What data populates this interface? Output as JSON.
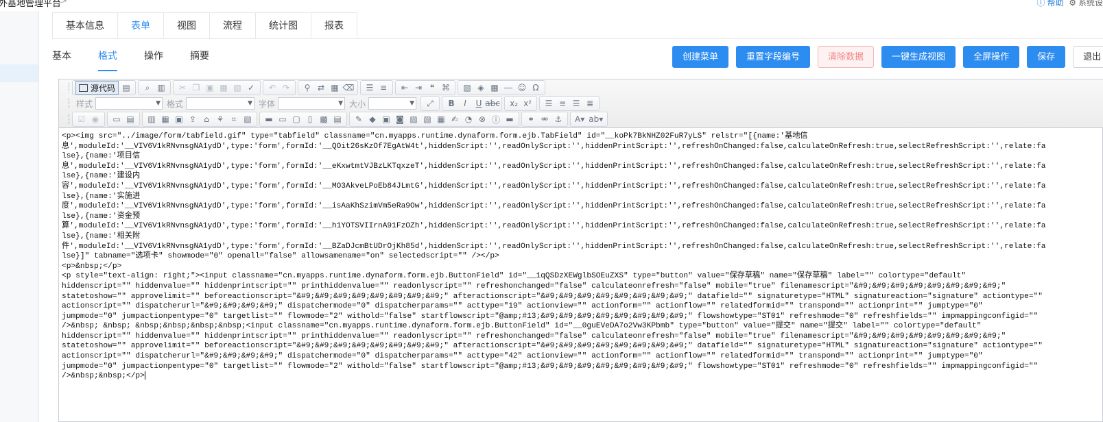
{
  "app": {
    "title": "外基地管理平台",
    "chevron": ">",
    "top_right": {
      "help_label": "帮助",
      "settings_label": "系统设"
    }
  },
  "tabs_primary": [
    {
      "label": "基本信息",
      "active": false
    },
    {
      "label": "表单",
      "active": true
    },
    {
      "label": "视图",
      "active": false
    },
    {
      "label": "流程",
      "active": false
    },
    {
      "label": "统计图",
      "active": false
    },
    {
      "label": "报表",
      "active": false
    }
  ],
  "tabs_secondary": [
    {
      "label": "基本",
      "active": false
    },
    {
      "label": "格式",
      "active": true
    },
    {
      "label": "操作",
      "active": false
    },
    {
      "label": "摘要",
      "active": false
    }
  ],
  "actions": {
    "create_menu": "创建菜单",
    "reset_field_number": "重置字段编号",
    "clear_data": "清除数据",
    "generate_view": "一键生成视图",
    "fullscreen": "全屏操作",
    "save": "保存",
    "exit": "退出"
  },
  "editor": {
    "source_label": "源代码",
    "style_label": "样式",
    "format_label": "格式",
    "font_label": "字体",
    "size_label": "大小",
    "lines": [
      "<p><img src=\"../image/form/tabfield.gif\" type=\"tabfield\" classname=\"cn.myapps.runtime.dynaform.form.ejb.TabField\" id=\"__koPk7BkNHZ02FuR7yLS\" relstr=\"[{name:'基地信",
      "息',moduleId:'__VIV6V1kRNvnsgNA1ydD',type:'form',formId:'__QOit26sKzOf7EgAtW4t',hiddenScript:'',readOnlyScript:'',hiddenPrintScript:'',refreshOnChanged:false,calculateOnRefresh:true,selectRefreshScript:'',relate:fa",
      "lse},{name:'项目信",
      "息',moduleId:'__VIV6V1kRNvnsgNA1ydD',type:'form',formId:'__eKxwtmtVJBzLKTqxzeT',hiddenScript:'',readOnlyScript:'',hiddenPrintScript:'',refreshOnChanged:false,calculateOnRefresh:true,selectRefreshScript:'',relate:fa",
      "lse},{name:'建设内",
      "容',moduleId:'__VIV6V1kRNvnsgNA1ydD',type:'form',formId:'__MO3AkveLPoEb84JLmtG',hiddenScript:'',readOnlyScript:'',hiddenPrintScript:'',refreshOnChanged:false,calculateOnRefresh:true,selectRefreshScript:'',relate:fa",
      "lse},{name:'实施进",
      "度',moduleId:'__VIV6V1kRNvnsgNA1ydD',type:'form',formId:'__isAaKhSzimVm5eRa9Ow',hiddenScript:'',readOnlyScript:'',hiddenPrintScript:'',refreshOnChanged:false,calculateOnRefresh:true,selectRefreshScript:'',relate:fa",
      "lse},{name:'资金预",
      "算',moduleId:'__VIV6V1kRNvnsgNA1ydD',type:'form',formId:'__h1YOTSVIIrnA91FzOZh',hiddenScript:'',readOnlyScript:'',hiddenPrintScript:'',refreshOnChanged:false,calculateOnRefresh:true,selectRefreshScript:'',relate:fa",
      "lse},{name:'相关附",
      "件',moduleId:'__VIV6V1kRNvnsgNA1ydD',type:'form',formId:'__BZaDJcmBtUDrOjKh85d',hiddenScript:'',readOnlyScript:'',hiddenPrintScript:'',refreshOnChanged:false,calculateOnRefresh:true,selectRefreshScript:'',relate:fa",
      "lse}]\" tabname=\"选项卡\" showmode=\"0\" openall=\"false\" allowsamename=\"on\" selectedscript=\"\" /></p>",
      "<p>&nbsp;</p>",
      "<p style=\"text-align: right;\"><input classname=\"cn.myapps.runtime.dynaform.form.ejb.ButtonField\" id=\"__1qQSDzXEWglbSOEuZXS\" type=\"button\" value=\"保存草稿\" name=\"保存草稿\" label=\"\" colortype=\"default\"",
      "hiddenscript=\"\" hiddenvalue=\"\" hiddenprintscript=\"\" printhiddenvalue=\"\" readonlyscript=\"\" refreshonchanged=\"false\" calculateonrefresh=\"false\" mobile=\"true\" filenamescript=\"&#9;&#9;&#9;&#9;&#9;&#9;&#9;&#9;\"",
      "statetoshow=\"\" approvelimit=\"\" beforeactionscript=\"&#9;&#9;&#9;&#9;&#9;&#9;&#9;&#9;\" afteractionscript=\"&#9;&#9;&#9;&#9;&#9;&#9;&#9;&#9;\" datafield=\"\" signaturetype=\"HTML\" signatureaction=\"signature\" actiontype=\"\"",
      "actionscript=\"\" dispatcherurl=\"&#9;&#9;&#9;&#9;\" dispatchermode=\"0\" dispatcherparams=\"\" acttype=\"19\" actionview=\"\" actionform=\"\" actionflow=\"\" relatedformid=\"\" transpond=\"\" actionprint=\"\" jumptype=\"0\"",
      "jumpmode=\"0\" jumpactionpentype=\"0\" targetlist=\"\" flowmode=\"2\" withold=\"false\" startflowscript=\"@amp;#13;&#9;&#9;&#9;&#9;&#9;&#9;&#9;&#9;\" flowshowtype=\"ST01\" refreshmode=\"0\" refreshfields=\"\" impmappingconfigid=\"\"",
      "/>&nbsp; &nbsp; &nbsp;&nbsp;&nbsp;&nbsp;<input classname=\"cn.myapps.runtime.dynaform.form.ejb.ButtonField\" id=\"__0guEVeDA7o2Vw3KPbmb\" type=\"button\" value=\"提交\" name=\"提交\" label=\"\" colortype=\"default\"",
      "hiddenscript=\"\" hiddenvalue=\"\" hiddenprintscript=\"\" printhiddenvalue=\"\" readonlyscript=\"\" refreshonchanged=\"false\" calculateonrefresh=\"false\" mobile=\"true\" filenamescript=\"&#9;&#9;&#9;&#9;&#9;&#9;&#9;&#9;\"",
      "statetoshow=\"\" approvelimit=\"\" beforeactionscript=\"&#9;&#9;&#9;&#9;&#9;&#9;&#9;&#9;\" afteractionscript=\"&#9;&#9;&#9;&#9;&#9;&#9;&#9;&#9;\" datafield=\"\" signaturetype=\"HTML\" signatureaction=\"signature\" actiontype=\"\"",
      "actionscript=\"\" dispatcherurl=\"&#9;&#9;&#9;&#9;\" dispatchermode=\"0\" dispatcherparams=\"\" acttype=\"42\" actionview=\"\" actionform=\"\" actionflow=\"\" relatedformid=\"\" transpond=\"\" actionprint=\"\" jumptype=\"0\"",
      "jumpmode=\"0\" jumpactionpentype=\"0\" targetlist=\"\" flowmode=\"2\" withold=\"false\" startflowscript=\"@amp;#13;&#9;&#9;&#9;&#9;&#9;&#9;&#9;&#9;\" flowshowtype=\"ST01\" refreshmode=\"0\" refreshfields=\"\" impmappingconfigid=\"\"",
      "/>&nbsp;&nbsp;</p>"
    ]
  },
  "colors": {
    "accent": "#2d8cf0",
    "danger_text": "#f08a8a",
    "border": "#e4e7ec"
  }
}
